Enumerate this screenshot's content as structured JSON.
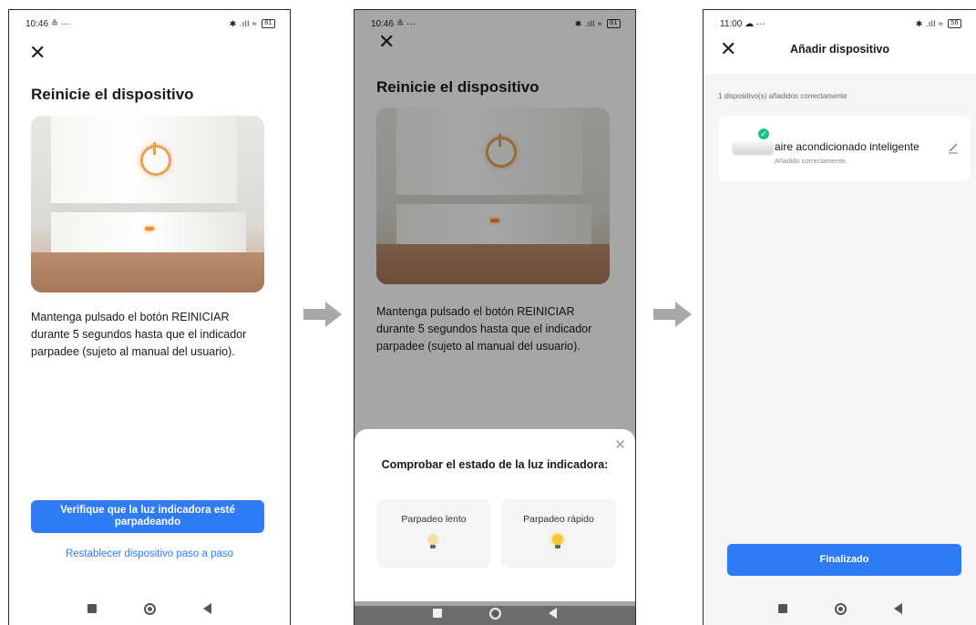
{
  "screen1": {
    "status_time": "10:46",
    "status_extra": "≗ ···",
    "status_icons": "✱ .ıll ≈",
    "battery": "81",
    "title": "Reinicie el dispositivo",
    "description": "Mantenga pulsado el botón REINICIAR durante 5 segundos hasta que el indicador parpadee (sujeto al manual del usuario).",
    "primary_button": "Verifique que la luz indicadora esté parpadeando",
    "link": "Restablecer dispositivo paso a paso"
  },
  "screen2": {
    "status_time": "10:46",
    "status_extra": "≗ ···",
    "status_icons": "✱ .ıll ≈",
    "battery": "81",
    "title": "Reinicie el dispositivo",
    "description": "Mantenga pulsado el botón REINICIAR durante 5 segundos hasta que el indicador parpadee (sujeto al manual del usuario).",
    "sheet_title": "Comprobar el estado de la luz indicadora:",
    "option_slow": "Parpadeo lento",
    "option_fast": "Parpadeo rápido"
  },
  "screen3": {
    "status_time": "11:00",
    "status_extra": "☁ ···",
    "status_icons": "✱ .ıll ≈",
    "battery": "56",
    "title": "Añadir dispositivo",
    "added_count": "1 dispositivo(s) añadidos correctamente",
    "device_name": "aire acondicionado inteligente",
    "device_status": "Añadido correctamente.",
    "done_button": "Finalizado"
  },
  "icons": {
    "close": "close-icon",
    "arrow": "arrow-right-icon",
    "check": "check-circle-icon",
    "edit": "pencil-icon",
    "bulb": "bulb-icon",
    "nav_recent": "square-icon",
    "nav_home": "circle-icon",
    "nav_back": "triangle-back-icon"
  },
  "colors": {
    "accent": "#2f7bf5",
    "success": "#1cbf8a",
    "arrow": "#a8a8a8"
  }
}
